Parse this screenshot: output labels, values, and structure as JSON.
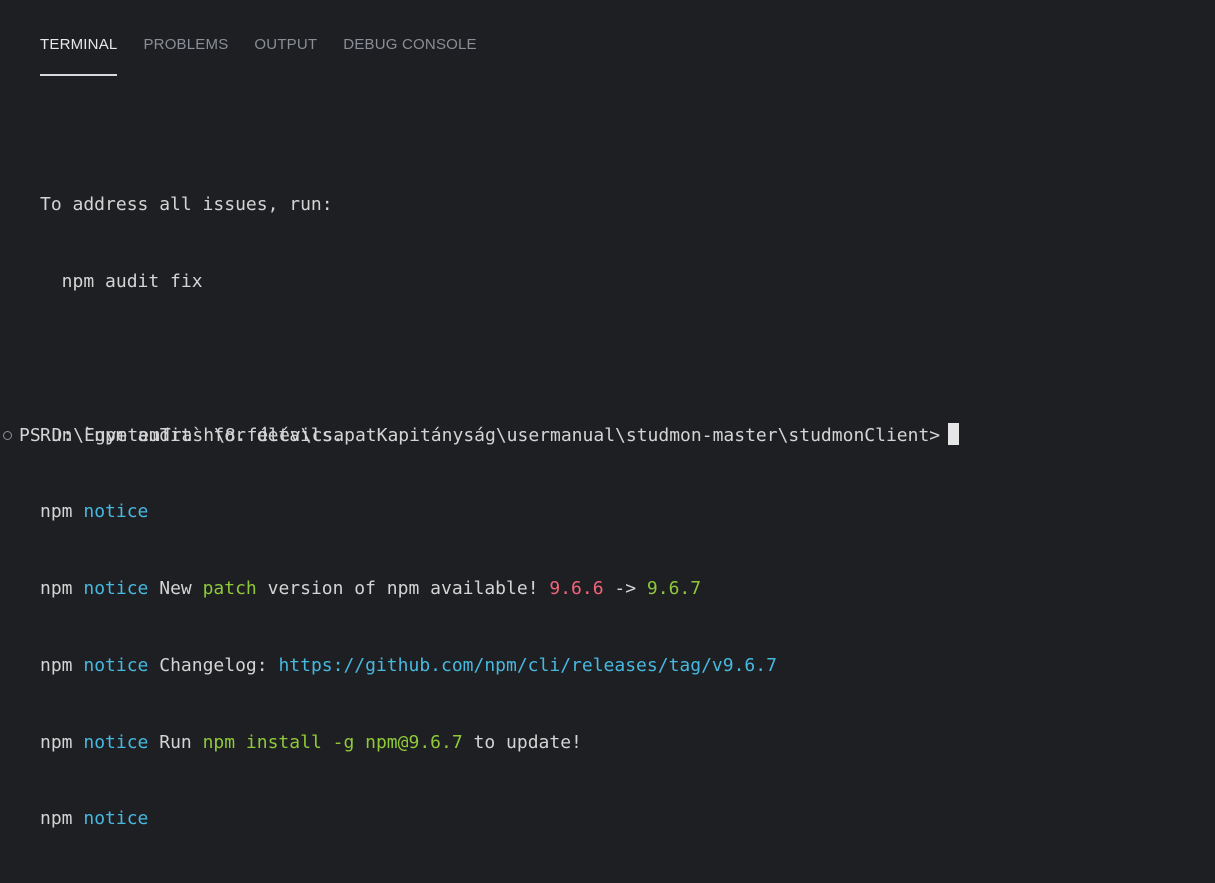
{
  "tabs": [
    {
      "label": "TERMINAL",
      "active": true
    },
    {
      "label": "PROBLEMS",
      "active": false
    },
    {
      "label": "OUTPUT",
      "active": false
    },
    {
      "label": "DEBUG CONSOLE",
      "active": false
    }
  ],
  "terminal": {
    "line1": "To address all issues, run:",
    "line2": "  npm audit fix",
    "line3": "Run `npm audit` for details.",
    "npm": "npm",
    "notice": "notice",
    "new_text": " New ",
    "patch": "patch",
    "version_text": " version of npm available! ",
    "old_version": "9.6.6",
    "arrow": " -> ",
    "new_version": "9.6.7",
    "changelog_label": " Changelog: ",
    "changelog_url": "https://github.com/npm/cli/releases/tag/v9.6.7",
    "run_label": " Run ",
    "install_cmd": "npm install -g npm@9.6.7",
    "to_update": " to update!"
  },
  "prompt": {
    "text": "PS D:\\EgyetemTrash\\8.félév\\csapatKapitányság\\usermanual\\studmon-master\\studmonClient>"
  },
  "colors": {
    "background": "#1e1f22",
    "cyan": "#47b8e0",
    "green": "#8fc93a",
    "red": "#f0657a",
    "text": "#d4d4d4"
  }
}
